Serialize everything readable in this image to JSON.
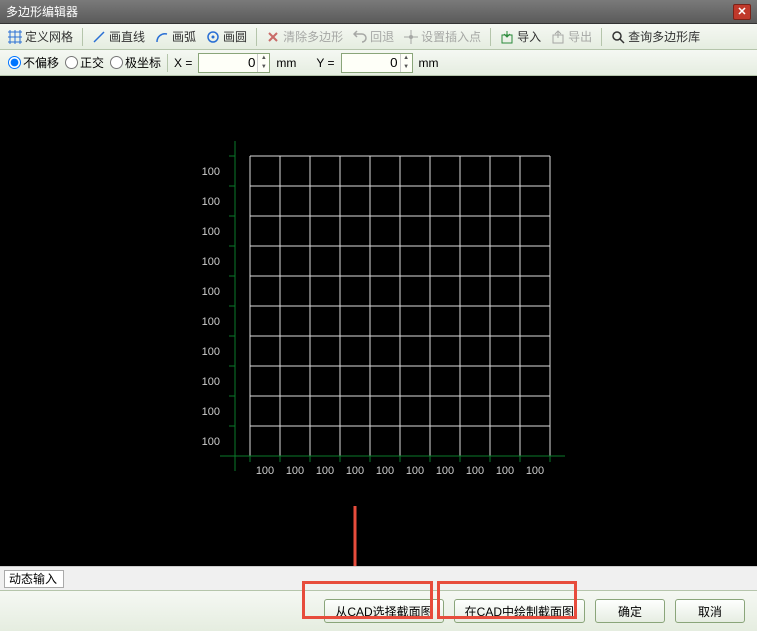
{
  "window": {
    "title": "多边形编辑器"
  },
  "toolbar": {
    "define_grid": "定义网格",
    "draw_line": "画直线",
    "draw_arc": "画弧",
    "draw_circle": "画圆",
    "clear_poly": "清除多边形",
    "undo": "回退",
    "set_insert": "设置插入点",
    "import": "导入",
    "export": "导出",
    "query_lib": "查询多边形库"
  },
  "options": {
    "no_offset": "不偏移",
    "ortho": "正交",
    "polar": "极坐标",
    "x_label": "X =",
    "x_value": "0",
    "y_label": "Y =",
    "y_value": "0",
    "unit": "mm"
  },
  "grid": {
    "axis_labels": [
      "100",
      "100",
      "100",
      "100",
      "100",
      "100",
      "100",
      "100",
      "100",
      "100"
    ]
  },
  "status": {
    "label": "动态输入"
  },
  "footer": {
    "from_cad": "从CAD选择截面图",
    "in_cad_draw": "在CAD中绘制截面图",
    "ok": "确定",
    "cancel": "取消"
  }
}
